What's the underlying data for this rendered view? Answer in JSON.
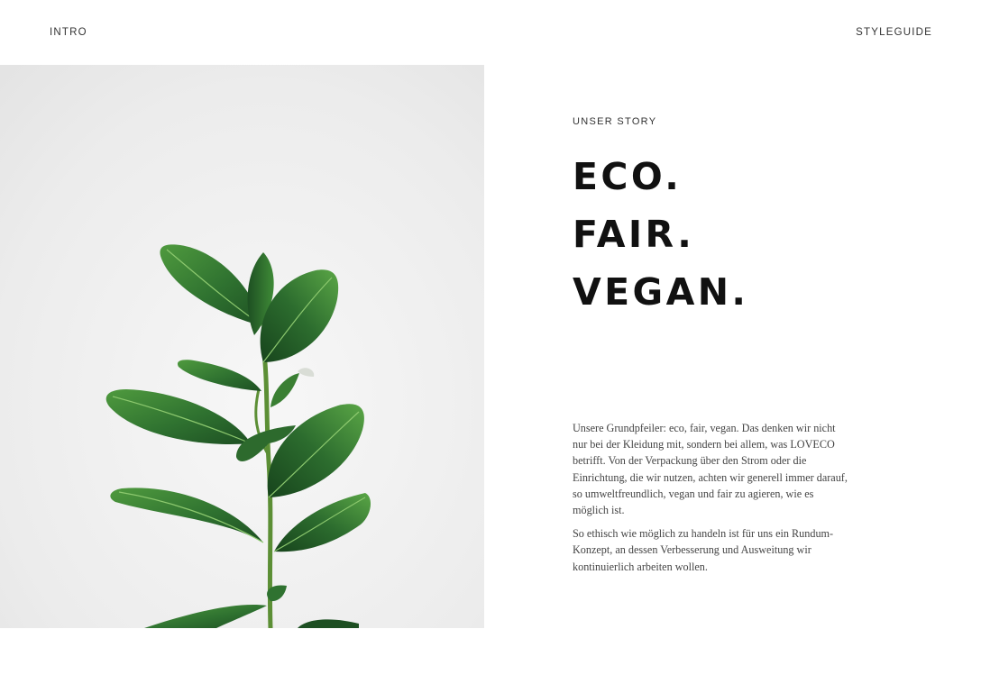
{
  "nav": {
    "left_label": "INTRO",
    "right_label": "STYLEGUIDE"
  },
  "hero_image": {
    "subject": "rubber plant icon",
    "background_color": "#eeeeee"
  },
  "story": {
    "eyebrow": "UNSER STORY",
    "headline_lines": [
      "ECO.",
      "FAIR.",
      "VEGAN."
    ],
    "paragraphs": [
      "Unsere Grundpfeiler: eco, fair, vegan. Das denken wir nicht nur bei der Kleidung mit, sondern bei allem, was LOVECO betrifft. Von der Verpackung über den Strom oder die Einrichtung, die wir nutzen, achten wir generell immer darauf, so umweltfreundlich, vegan und fair zu agieren, wie es möglich ist.",
      "So ethisch wie möglich zu handeln ist für uns ein Rundum-Konzept, an dessen Verbesserung und Ausweitung wir kontinuierlich arbeiten wollen."
    ]
  },
  "colors": {
    "text": "#111111",
    "muted_text": "#444444",
    "leaf_dark": "#1f5a23",
    "leaf_light": "#4f9a3e",
    "stem": "#5c8f35"
  }
}
